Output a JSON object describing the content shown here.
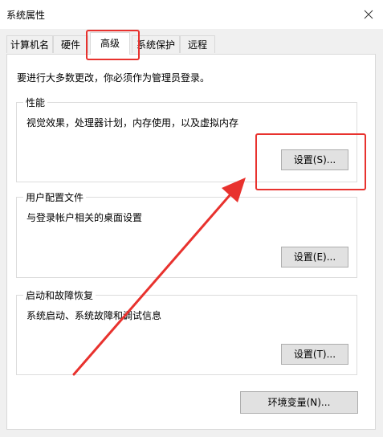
{
  "window": {
    "title": "系统属性",
    "close_icon": "close-icon"
  },
  "tabs": [
    {
      "label": "计算机名"
    },
    {
      "label": "硬件"
    },
    {
      "label": "高级",
      "selected": true
    },
    {
      "label": "系统保护"
    },
    {
      "label": "远程"
    }
  ],
  "advanced": {
    "intro": "要进行大多数更改，你必须作为管理员登录。",
    "performance": {
      "title": "性能",
      "description": "视觉效果，处理器计划，内存使用，以及虚拟内存",
      "button": "设置(S)..."
    },
    "user_profiles": {
      "title": "用户配置文件",
      "description": "与登录帐户相关的桌面设置",
      "button": "设置(E)..."
    },
    "startup_recovery": {
      "title": "启动和故障恢复",
      "description": "系统启动、系统故障和调试信息",
      "button": "设置(T)..."
    },
    "env_button": "环境变量(N)..."
  },
  "annotation": {
    "color": "#e8322e"
  }
}
